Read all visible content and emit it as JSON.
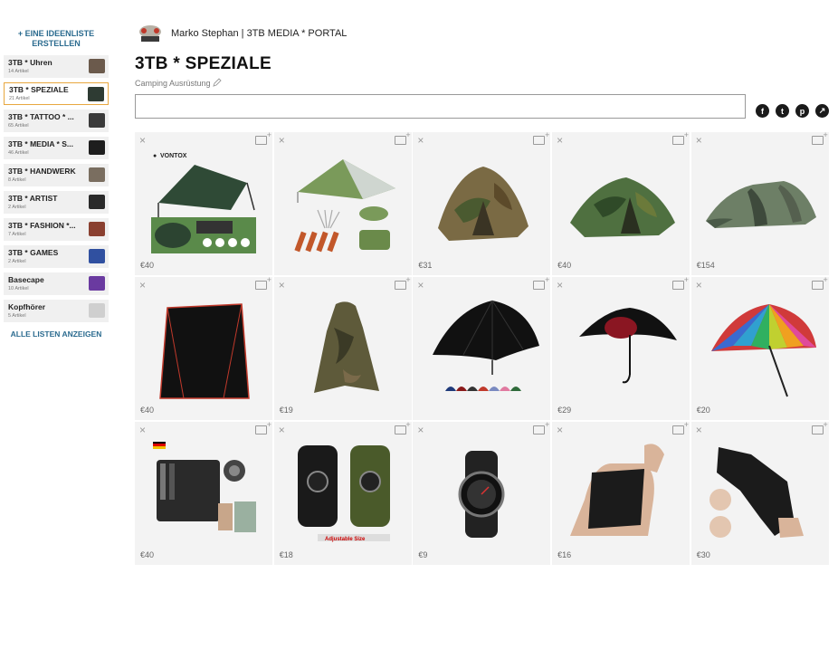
{
  "sidebar": {
    "create_label": "+ EINE IDEENLISTE ERSTELLEN",
    "show_all_label": "ALLE LISTEN ANZEIGEN",
    "lists": [
      {
        "name": "3TB * Uhren",
        "count": "14 Artikel",
        "thumb_color": "#6b5a4c",
        "active": false
      },
      {
        "name": "3TB * SPEZIALE",
        "count": "21 Artikel",
        "thumb_color": "#2e3b33",
        "active": true
      },
      {
        "name": "3TB * TATTOO * ...",
        "count": "65 Artikel",
        "thumb_color": "#3a3a3a",
        "active": false
      },
      {
        "name": "3TB * MEDIA * S...",
        "count": "46 Artikel",
        "thumb_color": "#1e1e1e",
        "active": false
      },
      {
        "name": "3TB * HANDWERK",
        "count": "8 Artikel",
        "thumb_color": "#7a6e60",
        "active": false
      },
      {
        "name": "3TB * ARTIST",
        "count": "2 Artikel",
        "thumb_color": "#2a2a2a",
        "active": false
      },
      {
        "name": "3TB * FASHION *...",
        "count": "7 Artikel",
        "thumb_color": "#8a4030",
        "active": false
      },
      {
        "name": "3TB * GAMES",
        "count": "2 Artikel",
        "thumb_color": "#3050a0",
        "active": false
      },
      {
        "name": "Basecape",
        "count": "10 Artikel",
        "thumb_color": "#6a3aa0",
        "active": false
      },
      {
        "name": "Kopfhörer",
        "count": "5 Artikel",
        "thumb_color": "#cfcfcf",
        "active": false
      }
    ]
  },
  "owner": {
    "name": "Marko Stephan | 3TB MEDIA * PORTAL"
  },
  "list": {
    "title": "3TB * SPEZIALE",
    "subtitle": "Camping Ausrüstung"
  },
  "search": {
    "value": "",
    "placeholder": ""
  },
  "share_icons": [
    "facebook-icon",
    "twitter-icon",
    "pinterest-icon",
    "share-icon"
  ],
  "items": [
    {
      "price": "€40",
      "kind": "tarp-dark"
    },
    {
      "price": "",
      "kind": "tarp-green"
    },
    {
      "price": "€31",
      "kind": "tent-camo"
    },
    {
      "price": "€40",
      "kind": "tent-camo2"
    },
    {
      "price": "€154",
      "kind": "tunnel-tent"
    },
    {
      "price": "€40",
      "kind": "popup-tent"
    },
    {
      "price": "€19",
      "kind": "poncho"
    },
    {
      "price": "",
      "kind": "umbrella-black"
    },
    {
      "price": "€29",
      "kind": "umbrella-red"
    },
    {
      "price": "€20",
      "kind": "umbrella-rainbow"
    },
    {
      "price": "€40",
      "kind": "survival-kit"
    },
    {
      "price": "€18",
      "kind": "paracord"
    },
    {
      "price": "€9",
      "kind": "watch"
    },
    {
      "price": "€16",
      "kind": "wrist-brace"
    },
    {
      "price": "€30",
      "kind": "hand-brace"
    }
  ],
  "image_texts": {
    "vontox": "VONTOX",
    "adjustable": "Adjustable Size"
  }
}
